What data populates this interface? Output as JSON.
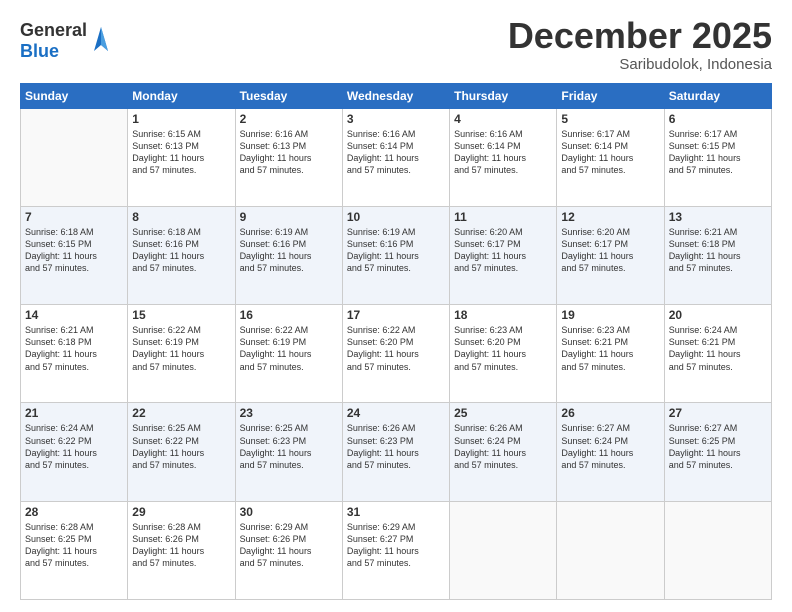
{
  "logo": {
    "general": "General",
    "blue": "Blue"
  },
  "header": {
    "month": "December 2025",
    "location": "Saribudolok, Indonesia"
  },
  "days": [
    "Sunday",
    "Monday",
    "Tuesday",
    "Wednesday",
    "Thursday",
    "Friday",
    "Saturday"
  ],
  "weeks": [
    [
      {
        "day": "",
        "info": ""
      },
      {
        "day": "1",
        "info": "Sunrise: 6:15 AM\nSunset: 6:13 PM\nDaylight: 11 hours\nand 57 minutes."
      },
      {
        "day": "2",
        "info": "Sunrise: 6:16 AM\nSunset: 6:13 PM\nDaylight: 11 hours\nand 57 minutes."
      },
      {
        "day": "3",
        "info": "Sunrise: 6:16 AM\nSunset: 6:14 PM\nDaylight: 11 hours\nand 57 minutes."
      },
      {
        "day": "4",
        "info": "Sunrise: 6:16 AM\nSunset: 6:14 PM\nDaylight: 11 hours\nand 57 minutes."
      },
      {
        "day": "5",
        "info": "Sunrise: 6:17 AM\nSunset: 6:14 PM\nDaylight: 11 hours\nand 57 minutes."
      },
      {
        "day": "6",
        "info": "Sunrise: 6:17 AM\nSunset: 6:15 PM\nDaylight: 11 hours\nand 57 minutes."
      }
    ],
    [
      {
        "day": "7",
        "info": "Sunrise: 6:18 AM\nSunset: 6:15 PM\nDaylight: 11 hours\nand 57 minutes."
      },
      {
        "day": "8",
        "info": "Sunrise: 6:18 AM\nSunset: 6:16 PM\nDaylight: 11 hours\nand 57 minutes."
      },
      {
        "day": "9",
        "info": "Sunrise: 6:19 AM\nSunset: 6:16 PM\nDaylight: 11 hours\nand 57 minutes."
      },
      {
        "day": "10",
        "info": "Sunrise: 6:19 AM\nSunset: 6:16 PM\nDaylight: 11 hours\nand 57 minutes."
      },
      {
        "day": "11",
        "info": "Sunrise: 6:20 AM\nSunset: 6:17 PM\nDaylight: 11 hours\nand 57 minutes."
      },
      {
        "day": "12",
        "info": "Sunrise: 6:20 AM\nSunset: 6:17 PM\nDaylight: 11 hours\nand 57 minutes."
      },
      {
        "day": "13",
        "info": "Sunrise: 6:21 AM\nSunset: 6:18 PM\nDaylight: 11 hours\nand 57 minutes."
      }
    ],
    [
      {
        "day": "14",
        "info": "Sunrise: 6:21 AM\nSunset: 6:18 PM\nDaylight: 11 hours\nand 57 minutes."
      },
      {
        "day": "15",
        "info": "Sunrise: 6:22 AM\nSunset: 6:19 PM\nDaylight: 11 hours\nand 57 minutes."
      },
      {
        "day": "16",
        "info": "Sunrise: 6:22 AM\nSunset: 6:19 PM\nDaylight: 11 hours\nand 57 minutes."
      },
      {
        "day": "17",
        "info": "Sunrise: 6:22 AM\nSunset: 6:20 PM\nDaylight: 11 hours\nand 57 minutes."
      },
      {
        "day": "18",
        "info": "Sunrise: 6:23 AM\nSunset: 6:20 PM\nDaylight: 11 hours\nand 57 minutes."
      },
      {
        "day": "19",
        "info": "Sunrise: 6:23 AM\nSunset: 6:21 PM\nDaylight: 11 hours\nand 57 minutes."
      },
      {
        "day": "20",
        "info": "Sunrise: 6:24 AM\nSunset: 6:21 PM\nDaylight: 11 hours\nand 57 minutes."
      }
    ],
    [
      {
        "day": "21",
        "info": "Sunrise: 6:24 AM\nSunset: 6:22 PM\nDaylight: 11 hours\nand 57 minutes."
      },
      {
        "day": "22",
        "info": "Sunrise: 6:25 AM\nSunset: 6:22 PM\nDaylight: 11 hours\nand 57 minutes."
      },
      {
        "day": "23",
        "info": "Sunrise: 6:25 AM\nSunset: 6:23 PM\nDaylight: 11 hours\nand 57 minutes."
      },
      {
        "day": "24",
        "info": "Sunrise: 6:26 AM\nSunset: 6:23 PM\nDaylight: 11 hours\nand 57 minutes."
      },
      {
        "day": "25",
        "info": "Sunrise: 6:26 AM\nSunset: 6:24 PM\nDaylight: 11 hours\nand 57 minutes."
      },
      {
        "day": "26",
        "info": "Sunrise: 6:27 AM\nSunset: 6:24 PM\nDaylight: 11 hours\nand 57 minutes."
      },
      {
        "day": "27",
        "info": "Sunrise: 6:27 AM\nSunset: 6:25 PM\nDaylight: 11 hours\nand 57 minutes."
      }
    ],
    [
      {
        "day": "28",
        "info": "Sunrise: 6:28 AM\nSunset: 6:25 PM\nDaylight: 11 hours\nand 57 minutes."
      },
      {
        "day": "29",
        "info": "Sunrise: 6:28 AM\nSunset: 6:26 PM\nDaylight: 11 hours\nand 57 minutes."
      },
      {
        "day": "30",
        "info": "Sunrise: 6:29 AM\nSunset: 6:26 PM\nDaylight: 11 hours\nand 57 minutes."
      },
      {
        "day": "31",
        "info": "Sunrise: 6:29 AM\nSunset: 6:27 PM\nDaylight: 11 hours\nand 57 minutes."
      },
      {
        "day": "",
        "info": ""
      },
      {
        "day": "",
        "info": ""
      },
      {
        "day": "",
        "info": ""
      }
    ]
  ]
}
